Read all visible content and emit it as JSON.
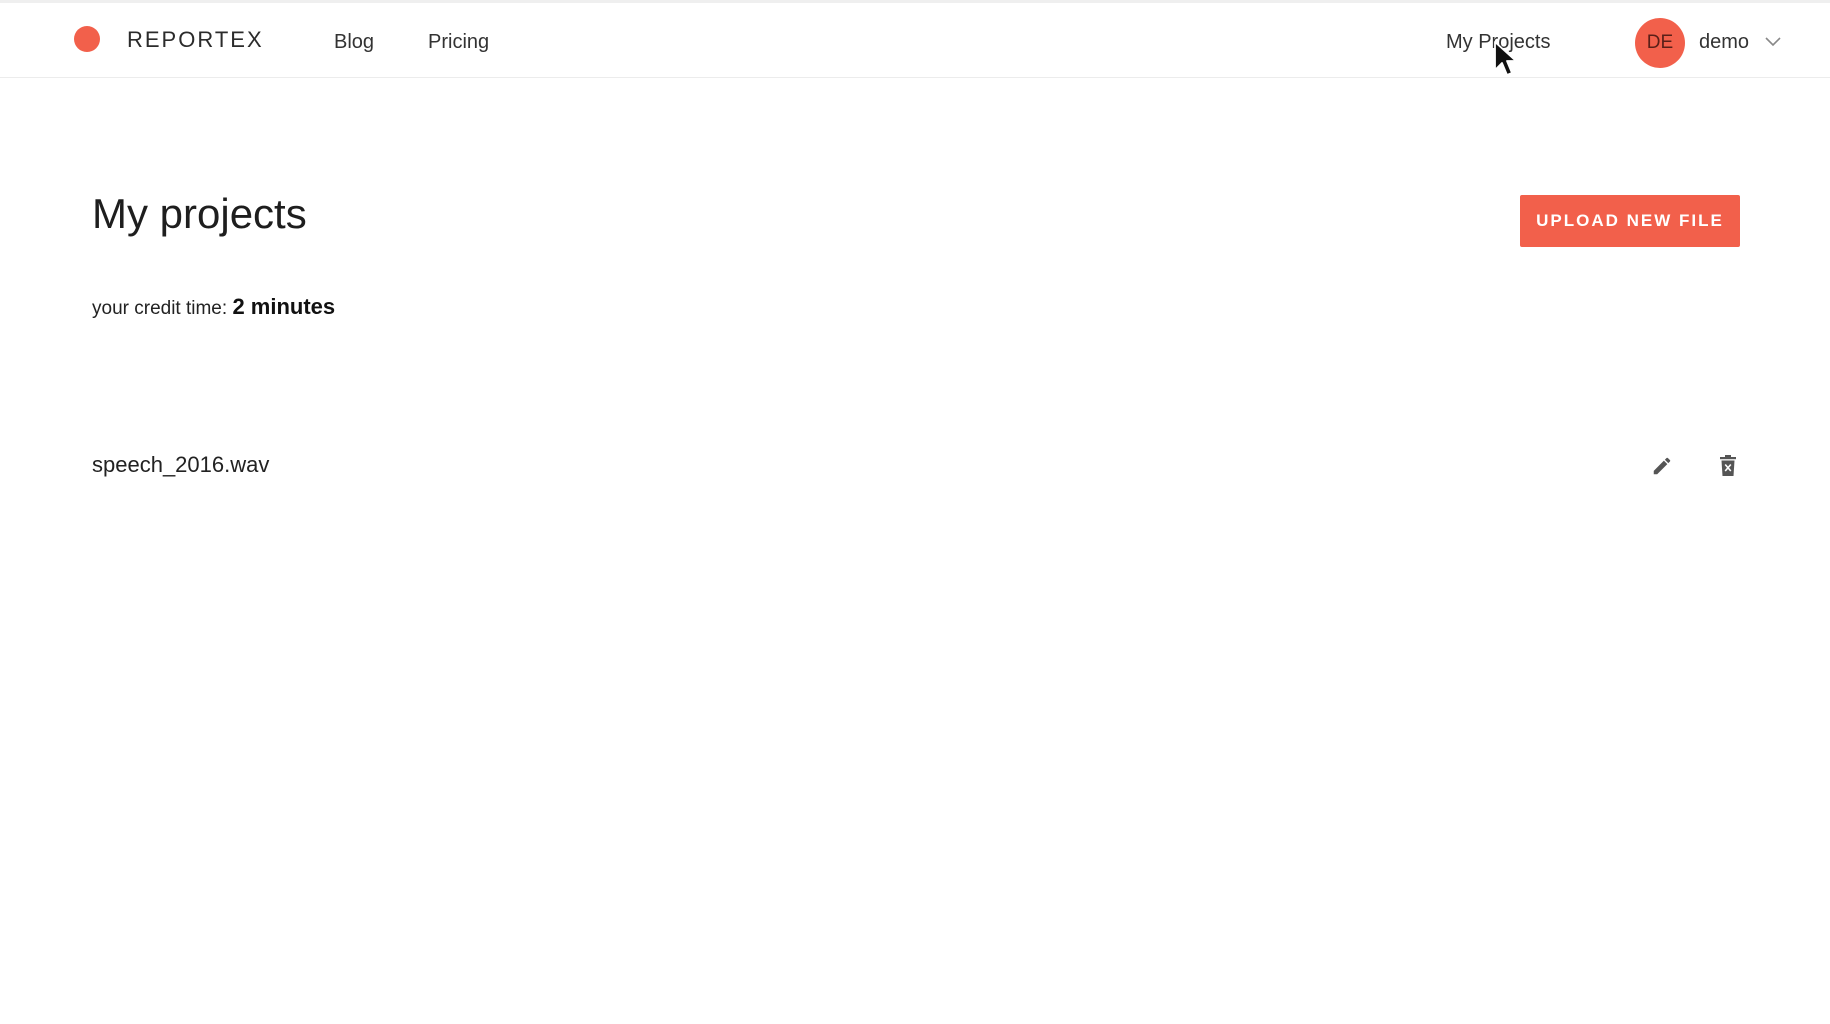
{
  "header": {
    "brand": "REPORTEX",
    "nav": {
      "blog": "Blog",
      "pricing": "Pricing",
      "my_projects": "My Projects"
    },
    "user": {
      "initials": "DE",
      "name": "demo"
    }
  },
  "main": {
    "title": "My projects",
    "upload_label": "UPLOAD NEW FILE",
    "credit_label": "your credit time:",
    "credit_value": "2 minutes",
    "files": [
      {
        "name": "speech_2016.wav"
      }
    ]
  },
  "icons": {
    "logo": "circle-logo-icon",
    "chevron": "chevron-down-icon",
    "edit": "pencil-icon",
    "delete": "trash-icon",
    "cursor": "mouse-pointer-icon"
  },
  "colors": {
    "accent": "#f2604b",
    "text": "#222222",
    "border": "#ececec"
  }
}
